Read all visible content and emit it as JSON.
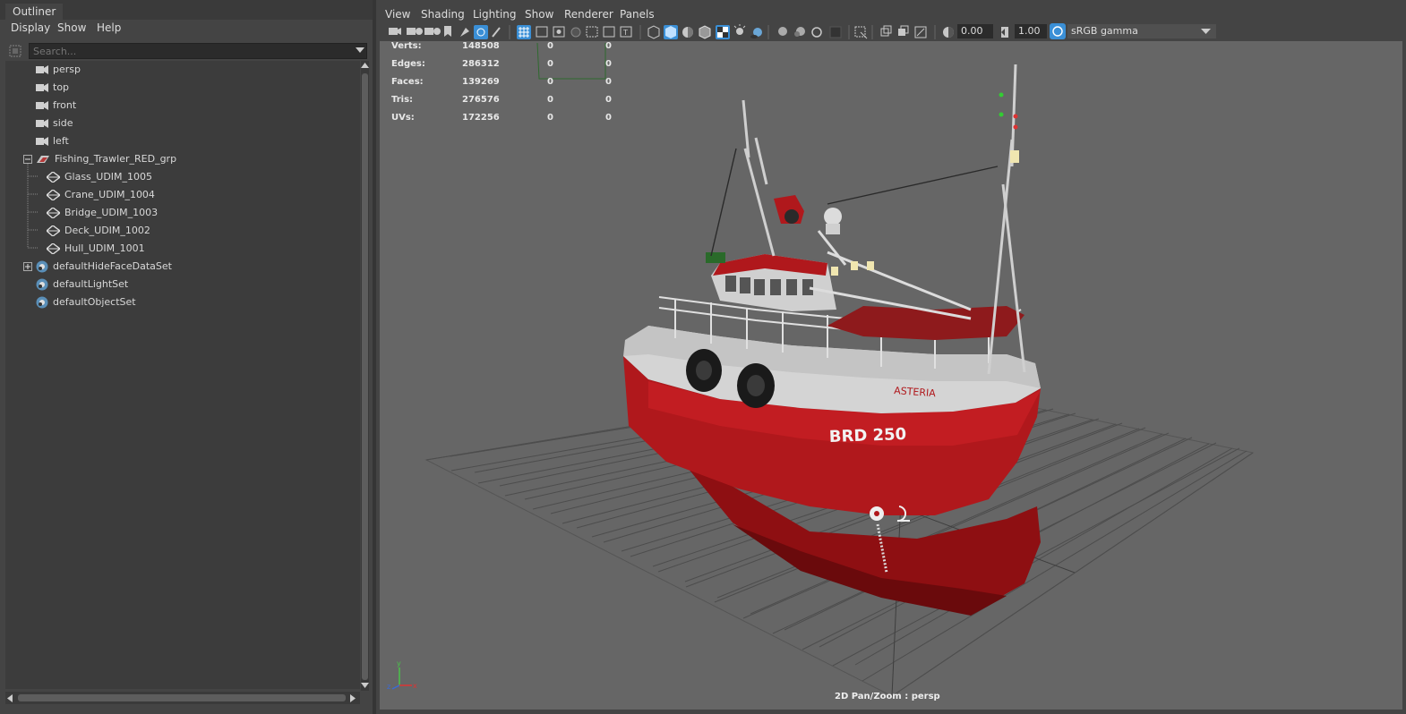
{
  "outliner": {
    "tab_label": "Outliner",
    "menu": [
      "Display",
      "Show",
      "Help"
    ],
    "search_placeholder": "Search...",
    "items": [
      {
        "label": "persp",
        "icon": "camera-icon"
      },
      {
        "label": "top",
        "icon": "camera-icon"
      },
      {
        "label": "front",
        "icon": "camera-icon"
      },
      {
        "label": "side",
        "icon": "camera-icon"
      },
      {
        "label": "left",
        "icon": "camera-icon"
      },
      {
        "label": "Fishing_Trawler_RED_grp",
        "icon": "group-icon",
        "expander": "-"
      },
      {
        "label": "Glass_UDIM_1005",
        "icon": "mesh-icon"
      },
      {
        "label": "Crane_UDIM_1004",
        "icon": "mesh-icon"
      },
      {
        "label": "Bridge_UDIM_1003",
        "icon": "mesh-icon"
      },
      {
        "label": "Deck_UDIM_1002",
        "icon": "mesh-icon"
      },
      {
        "label": "Hull_UDIM_1001",
        "icon": "mesh-icon"
      },
      {
        "label": "defaultHideFaceDataSet",
        "icon": "set-icon",
        "expander": "+"
      },
      {
        "label": "defaultLightSet",
        "icon": "set-icon"
      },
      {
        "label": "defaultObjectSet",
        "icon": "set-icon"
      }
    ]
  },
  "viewport": {
    "menu": [
      "View",
      "Shading",
      "Lighting",
      "Show",
      "Renderer",
      "Panels"
    ],
    "exposure": "0.00",
    "gamma": "1.00",
    "color_space": "sRGB gamma",
    "camera_label": "2D Pan/Zoom : persp",
    "stats": [
      {
        "label": "Verts:",
        "total": "148508",
        "selected": "0",
        "component": "0"
      },
      {
        "label": "Edges:",
        "total": "286312",
        "selected": "0",
        "component": "0"
      },
      {
        "label": "Faces:",
        "total": "139269",
        "selected": "0",
        "component": "0"
      },
      {
        "label": "Tris:",
        "total": "276576",
        "selected": "0",
        "component": "0"
      },
      {
        "label": "UVs:",
        "total": "172256",
        "selected": "0",
        "component": "0"
      }
    ],
    "boat": {
      "registration": "BRD 250",
      "name": "ASTERIA",
      "hull_color": "#b0181c",
      "superstructure_color": "#d4d4d4"
    },
    "axis": {
      "x": "x",
      "y": "y",
      "z": "z"
    }
  },
  "colors": {
    "panel_bg": "#444444",
    "viewport_bg": "#666666",
    "accent": "#3a8fd6",
    "grid": "#4c4c4c"
  }
}
